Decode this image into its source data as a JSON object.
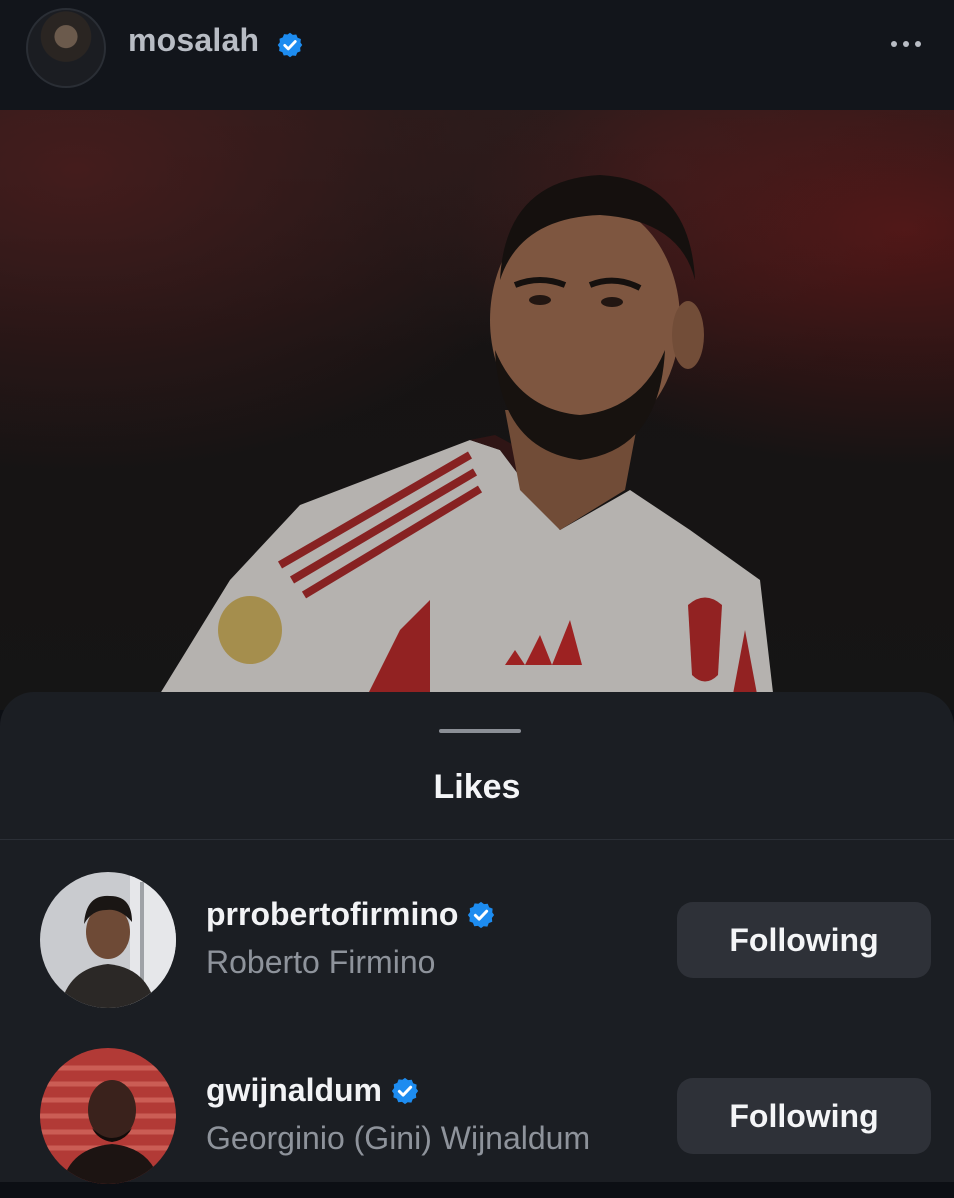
{
  "header": {
    "username": "mosalah",
    "verified": true,
    "more_icon": "more-horizontal-icon"
  },
  "likes_sheet": {
    "title": "Likes",
    "users": [
      {
        "handle": "prrobertofirmino",
        "full_name": "Roberto Firmino",
        "verified": true,
        "button_label": "Following"
      },
      {
        "handle": "gwijnaldum",
        "full_name": "Georginio (Gini) Wijnaldum",
        "verified": true,
        "button_label": "Following"
      }
    ]
  },
  "colors": {
    "verified_blue": "#1d8cf0",
    "sheet_bg": "#1b1e23",
    "button_bg": "#2e3138"
  }
}
